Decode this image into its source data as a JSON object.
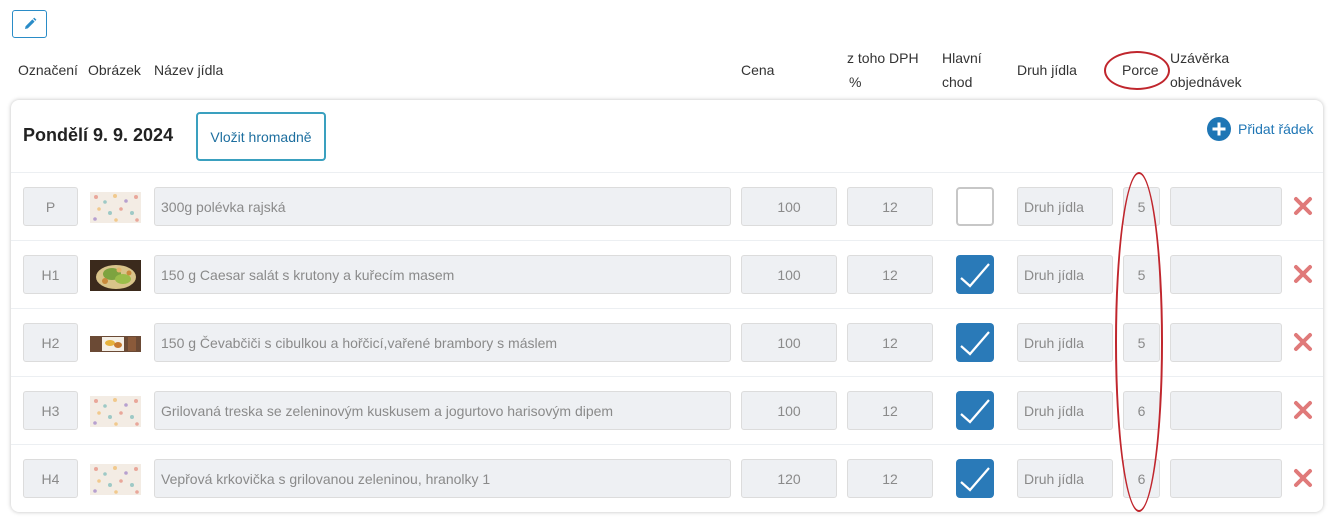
{
  "toolbar": {
    "edit_icon": "pencil-icon"
  },
  "columns": {
    "oznaceni": "Označení",
    "obrazek": "Obrázek",
    "nazev": "Název jídla",
    "cena": "Cena",
    "dph_line1": "z toho DPH",
    "dph_line2": "%",
    "hlavni_line1": "Hlavní",
    "hlavni_line2": "chod",
    "druh": "Druh jídla",
    "porce": "Porce",
    "uzaverka_line1": "Uzávěrka",
    "uzaverka_line2": "objednávek"
  },
  "day": {
    "title": "Pondělí 9. 9. 2024",
    "bulk_label": "Vložit hromadně",
    "add_row_label": "Přidat řádek"
  },
  "rows": [
    {
      "code": "P",
      "name": "300g polévka rajská",
      "price": "100",
      "vat": "12",
      "main": false,
      "type_placeholder": "Druh jídla",
      "portions": "5",
      "deadline": "",
      "image": "placeholder-pattern"
    },
    {
      "code": "H1",
      "name": "150 g Caesar salát s krutony a kuřecím masem",
      "price": "100",
      "vat": "12",
      "main": true,
      "type_placeholder": "Druh jídla",
      "portions": "5",
      "deadline": "",
      "image": "salad-photo"
    },
    {
      "code": "H2",
      "name": "150 g Čevabčiči s cibulkou a hořčicí,vařené brambory s máslem",
      "price": "100",
      "vat": "12",
      "main": true,
      "type_placeholder": "Druh jídla",
      "portions": "5",
      "deadline": "",
      "image": "cevapcici-photo"
    },
    {
      "code": "H3",
      "name": "Grilovaná treska se zeleninovým kuskusem a jogurtovo harisovým dipem",
      "price": "100",
      "vat": "12",
      "main": true,
      "type_placeholder": "Druh jídla",
      "portions": "6",
      "deadline": "",
      "image": "placeholder-pattern"
    },
    {
      "code": "H4",
      "name": "Vepřová krkovička s grilovanou zeleninou, hranolky 1",
      "price": "120",
      "vat": "12",
      "main": true,
      "type_placeholder": "Druh jídla",
      "portions": "6",
      "deadline": "",
      "image": "placeholder-pattern"
    }
  ],
  "colors": {
    "accent": "#2a7ab8",
    "delete": "#e07a7a",
    "annotation": "#c0262d"
  }
}
